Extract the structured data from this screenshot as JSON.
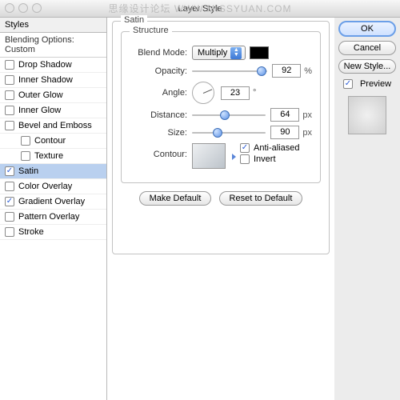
{
  "title": "Layer Style",
  "watermark": "思缘设计论坛   WWW.MISSYUAN.COM",
  "sidebar": {
    "header": "Styles",
    "blending": "Blending Options: Custom",
    "items": [
      {
        "label": "Drop Shadow",
        "checked": false,
        "indent": false
      },
      {
        "label": "Inner Shadow",
        "checked": false,
        "indent": false
      },
      {
        "label": "Outer Glow",
        "checked": false,
        "indent": false
      },
      {
        "label": "Inner Glow",
        "checked": false,
        "indent": false
      },
      {
        "label": "Bevel and Emboss",
        "checked": false,
        "indent": false
      },
      {
        "label": "Contour",
        "checked": false,
        "indent": true
      },
      {
        "label": "Texture",
        "checked": false,
        "indent": true
      },
      {
        "label": "Satin",
        "checked": true,
        "indent": false,
        "selected": true
      },
      {
        "label": "Color Overlay",
        "checked": false,
        "indent": false
      },
      {
        "label": "Gradient Overlay",
        "checked": true,
        "indent": false
      },
      {
        "label": "Pattern Overlay",
        "checked": false,
        "indent": false
      },
      {
        "label": "Stroke",
        "checked": false,
        "indent": false
      }
    ]
  },
  "panel": {
    "title": "Satin",
    "structure": "Structure",
    "blend_mode_label": "Blend Mode:",
    "blend_mode_value": "Multiply",
    "swatch_color": "#000000",
    "opacity_label": "Opacity:",
    "opacity_value": "92",
    "percent": "%",
    "angle_label": "Angle:",
    "angle_value": "23",
    "degree": "°",
    "distance_label": "Distance:",
    "distance_value": "64",
    "size_label": "Size:",
    "size_value": "90",
    "px": "px",
    "contour_label": "Contour:",
    "anti_aliased": "Anti-aliased",
    "invert": "Invert",
    "make_default": "Make Default",
    "reset_default": "Reset to Default"
  },
  "right": {
    "ok": "OK",
    "cancel": "Cancel",
    "new_style": "New Style...",
    "preview": "Preview"
  }
}
